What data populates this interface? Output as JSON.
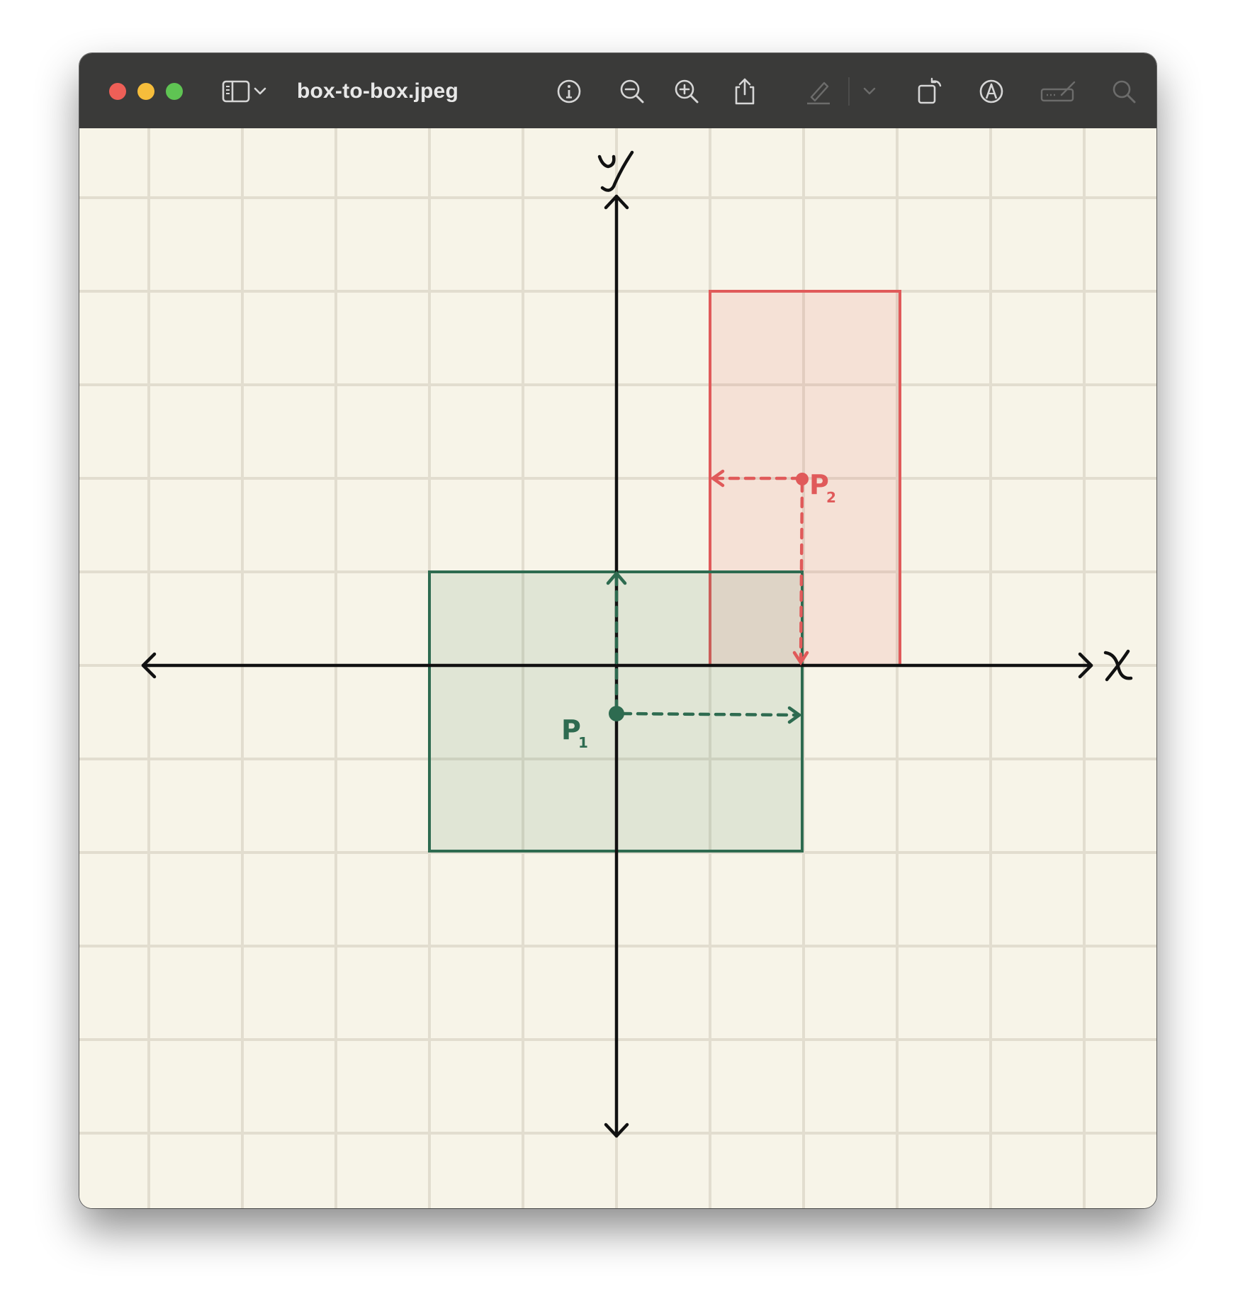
{
  "window": {
    "title": "box-to-box.jpeg"
  },
  "traffic_lights": {
    "close_color": "#ee5f57",
    "minimize_color": "#f6bd3b",
    "zoom_color": "#5fc453"
  },
  "toolbar": {
    "icons": [
      "sidebar-icon",
      "chevron-down-icon",
      "info-icon",
      "zoom-out-icon",
      "zoom-in-icon",
      "share-icon",
      "highlight-icon",
      "chevron-down-icon",
      "rotate-icon",
      "markup-icon",
      "signature-icon",
      "search-icon"
    ]
  },
  "diagram": {
    "x_axis_label": "x",
    "y_axis_label": "y",
    "p1_label": "P",
    "p1_subscript": "1",
    "p2_label": "P",
    "p2_subscript": "2",
    "green_color": "#2e6b50",
    "red_color": "#e05a5a",
    "grid_color": "#e2ddcf",
    "background_color": "#f7f4e8"
  }
}
